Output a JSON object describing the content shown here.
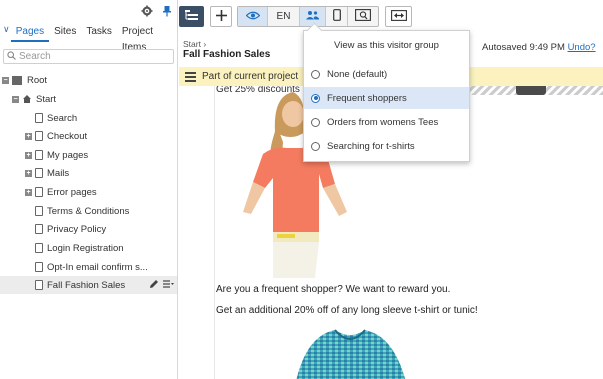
{
  "sidebar": {
    "tabs": [
      {
        "label": "Pages"
      },
      {
        "label": "Sites"
      },
      {
        "label": "Tasks"
      },
      {
        "label": "Project Items"
      }
    ],
    "search_placeholder": "Search",
    "tree": [
      {
        "label": "Root"
      },
      {
        "label": "Start"
      },
      {
        "label": "Search"
      },
      {
        "label": "Checkout"
      },
      {
        "label": "My pages"
      },
      {
        "label": "Mails"
      },
      {
        "label": "Error pages"
      },
      {
        "label": "Terms & Conditions"
      },
      {
        "label": "Privacy Policy"
      },
      {
        "label": "Login Registration"
      },
      {
        "label": "Opt-In email confirm s..."
      },
      {
        "label": "Fall Fashion Sales"
      }
    ]
  },
  "toolbar": {
    "language": "EN"
  },
  "header": {
    "breadcrumb": "Start",
    "page_title": "Fall Fashion Sales",
    "autosave_text": "Autosaved 9:49 PM",
    "undo_label": "Undo?"
  },
  "banner": {
    "text": "Part of current project"
  },
  "content": {
    "promo_partial": "Get 25% discounts o",
    "line1": "Are you a frequent shopper? We want to reward you.",
    "line2": "Get an additional 20% off of any long sleeve t-shirt or tunic!"
  },
  "visitor_dropdown": {
    "title": "View as this visitor group",
    "options": [
      {
        "label": "None (default)",
        "selected": false
      },
      {
        "label": "Frequent shoppers",
        "selected": true
      },
      {
        "label": "Orders from womens Tees",
        "selected": false
      },
      {
        "label": "Searching for t-shirts",
        "selected": false
      }
    ]
  },
  "colors": {
    "accent": "#1f6fc0",
    "banner_bg": "#fbf2bf",
    "selected_option_bg": "#dbe7f6"
  }
}
